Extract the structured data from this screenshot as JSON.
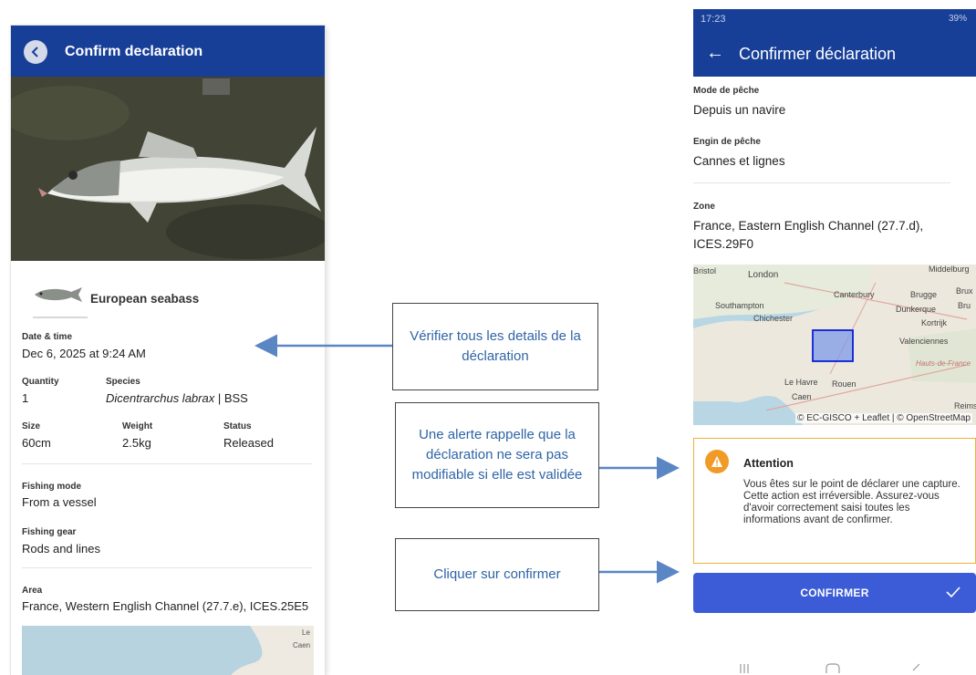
{
  "left_screen": {
    "header_title": "Confirm declaration",
    "species_common": "European seabass",
    "fields": {
      "date_label": "Date & time",
      "date_value": "Dec 6, 2025 at 9:24 AM",
      "quantity_label": "Quantity",
      "quantity_value": "1",
      "species_label": "Species",
      "species_latin": "Dicentrarchus labrax",
      "species_code": " | BSS",
      "size_label": "Size",
      "size_value": "60cm",
      "weight_label": "Weight",
      "weight_value": "2.5kg",
      "status_label": "Status",
      "status_value": "Released",
      "fishing_mode_label": "Fishing mode",
      "fishing_mode_value": "From a vessel",
      "fishing_gear_label": "Fishing gear",
      "fishing_gear_value": "Rods and lines",
      "area_label": "Area",
      "area_value": "France, Western English Channel (27.7.e), ICES.25E5"
    },
    "map_labels": {
      "le": "Le",
      "caen": "Caen"
    }
  },
  "callouts": {
    "verify": "Vérifier tous les details de la déclaration",
    "alert": "Une alerte rappelle que la déclaration ne sera pas modifiable si elle est validée",
    "confirm": "Cliquer sur confirmer"
  },
  "right_screen": {
    "status_time": "17:23",
    "status_battery": "39%",
    "header_title": "Confirmer déclaration",
    "mode_label": "Mode de pêche",
    "mode_value": "Depuis un navire",
    "gear_label": "Engin de pêche",
    "gear_value": "Cannes et lignes",
    "zone_label": "Zone",
    "zone_value_line1": "France, Eastern English Channel (27.7.d),",
    "zone_value_line2": "ICES.29F0",
    "map": {
      "labels": [
        "Bristol",
        "London",
        "Southampton",
        "Chichester",
        "Canterbury",
        "Brugge",
        "Dunkerque",
        "Kortrijk",
        "Valenciennes",
        "Hauts-de-France",
        "Le Havre",
        "Rouen",
        "Caen",
        "Reims",
        "Middelburg",
        "Brux",
        "Bru"
      ],
      "credit": "© EC-GISCO + Leaflet | © OpenStreetMap"
    },
    "alert_title": "Attention",
    "alert_text": "Vous êtes sur le point de déclarer une capture. Cette action est irréversible. Assurez-vous d'avoir correctement saisi toutes les informations avant de confirmer.",
    "confirm_label": "CONFIRMER"
  },
  "colors": {
    "header_blue": "#183f98",
    "confirm_blue": "#3b5cd6",
    "alert_orange": "#f29a26",
    "callout_text": "#2f64a6",
    "arrow": "#5b86c4"
  }
}
